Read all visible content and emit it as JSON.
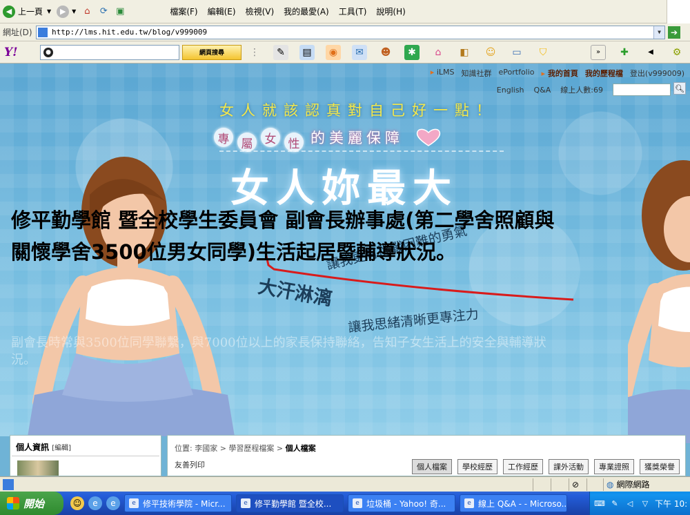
{
  "browser": {
    "back_label": "上一頁",
    "menus": [
      "檔案(F)",
      "編輯(E)",
      "檢視(V)",
      "我的最愛(A)",
      "工具(T)",
      "說明(H)"
    ],
    "address_label": "網址(D)",
    "address_value": "http://lms.hit.edu.tw/blog/v999009"
  },
  "yahoo": {
    "logo": "Y!",
    "search_button": "網頁搜尋"
  },
  "site": {
    "top_links": [
      "iLMS",
      "知識社群",
      "ePortfolio",
      "我的首頁",
      "我的歷程檔",
      "登出(v999009)"
    ],
    "second_links": [
      "English",
      "Q&A",
      "線上人數:69"
    ]
  },
  "banner": {
    "slogan_line1": "女人就該認真對自己好一點！",
    "slogan_bubbles": [
      "專",
      "屬",
      "女",
      "性"
    ],
    "slogan_line2_rest": "的美麗保障",
    "big_title": "女人妳最大",
    "script_line1": "讓我更有挑戰困難的勇氣",
    "script_big": "大汗淋漓",
    "script_line2": "讓我思緒清晰更專注力"
  },
  "overlay": {
    "headline": "修平勤學館 暨全校學生委員會 副會長辦事處(第二學舍照顧與關懷學舍3500位男女同學)生活起居暨輔導狀況。",
    "faint_text": "副會長時常與3500位同學聯繫，與7000位以上的家長保持聯絡，告知子女生活上的安全與輔導狀況。"
  },
  "blog": {
    "left_title": "個人資訊",
    "left_edit": "[編輯]",
    "breadcrumb_prefix": "位置:",
    "breadcrumb": [
      "李國家",
      "學習歷程檔案"
    ],
    "breadcrumb_current": "個人檔案",
    "print_link": "友善列印",
    "tabs": [
      "個人檔案",
      "學校經歷",
      "工作經歷",
      "課外活動",
      "專業證照",
      "獲獎榮譽"
    ]
  },
  "status": {
    "zone": "網際網路"
  },
  "taskbar": {
    "start": "開始",
    "tasks": [
      "修平技術學院 - Micr...",
      "修平勤學館 暨全校...",
      "垃圾桶 - Yahoo! 奇...",
      "線上 Q&A - - Microso..."
    ],
    "clock": "下午 10:"
  },
  "colors": {
    "banner_blue": "#6fb3d6",
    "slogan_yellow": "#f5e84a",
    "taskbar_blue": "#245edb",
    "red_annotation": "#d81b1b"
  }
}
